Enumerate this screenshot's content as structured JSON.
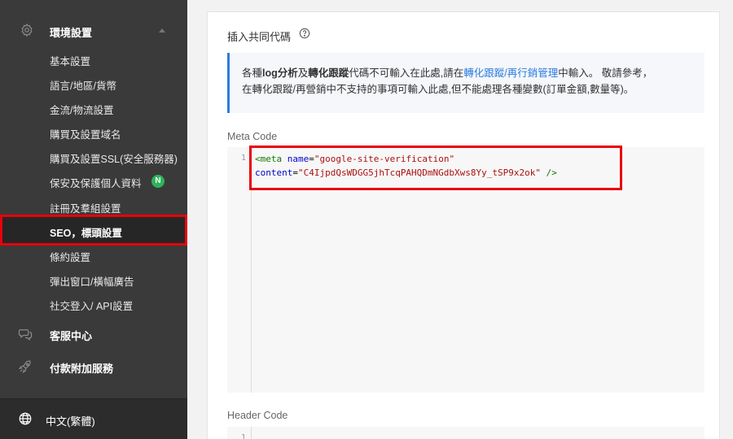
{
  "sidebar": {
    "section": {
      "label": "環境設置",
      "icon": "gear-icon"
    },
    "sub_items": [
      {
        "label": "基本設置"
      },
      {
        "label": "語言/地區/貨幣"
      },
      {
        "label": "金流/物流設置"
      },
      {
        "label": "購買及設置域名"
      },
      {
        "label": "購買及設置SSL(安全服務器)"
      },
      {
        "label": "保安及保護個人資料",
        "badge": "N"
      },
      {
        "label": "註冊及羣組設置"
      },
      {
        "label": "SEO，標頭設置",
        "active": true
      },
      {
        "label": "條約設置"
      },
      {
        "label": "彈出窗口/橫幅廣告"
      },
      {
        "label": "社交登入/ API設置"
      }
    ],
    "top_items": [
      {
        "label": "客服中心",
        "icon": "chat-icon"
      },
      {
        "label": "付款附加服務",
        "icon": "rocket-icon"
      }
    ],
    "language": {
      "label": "中文(繁體)",
      "icon": "globe-icon"
    }
  },
  "main": {
    "title": "插入共同代碼",
    "notice": {
      "t1": "各種",
      "b1": "log分析",
      "t2": "及",
      "b2": "轉化跟蹤",
      "t3": "代碼不可輸入在此處,請在",
      "link": "轉化跟蹤/再行銷管理",
      "t4": "中輸入。 敬請參考，",
      "line2": "在轉化跟蹤/再營銷中不支持的事項可輸入此處,但不能處理各種變數(訂單金額,數量等)。"
    },
    "meta_code": {
      "label": "Meta Code",
      "line_number": "1",
      "open": "<meta",
      "name_attr": "name",
      "eq": "=",
      "name_val": "\"google-site-verification\"",
      "content_attr": "content",
      "content_val": "\"C4IjpdQsWDGG5jhTcqPAHQDmNGdbXws8Yy_tSP9x2ok\"",
      "close": " />"
    },
    "header_code": {
      "label": "Header Code",
      "line_number": "1"
    }
  },
  "colors": {
    "accent_blue": "#2d7ce0",
    "highlight_red": "#e8000b",
    "sidebar_bg": "#3a3a3a",
    "badge_green": "#2fb35a"
  }
}
